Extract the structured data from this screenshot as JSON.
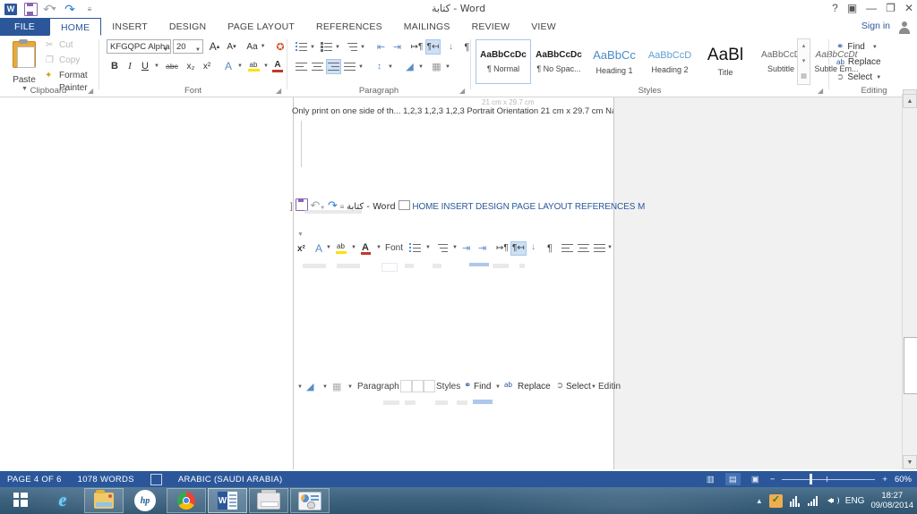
{
  "window": {
    "title": "كتابة - Word",
    "quick_access": [
      "word-logo",
      "save",
      "undo",
      "redo",
      "customize"
    ],
    "controls": {
      "help": "?",
      "ribbon_display": "▣",
      "minimize": "—",
      "restore": "❐",
      "close": "✕"
    }
  },
  "ribbon": {
    "tabs": [
      {
        "label": "FILE",
        "state": "file"
      },
      {
        "label": "HOME",
        "state": "active"
      },
      {
        "label": "INSERT",
        "state": "normal"
      },
      {
        "label": "DESIGN",
        "state": "normal"
      },
      {
        "label": "PAGE LAYOUT",
        "state": "normal"
      },
      {
        "label": "REFERENCES",
        "state": "normal"
      },
      {
        "label": "MAILINGS",
        "state": "normal"
      },
      {
        "label": "REVIEW",
        "state": "normal"
      },
      {
        "label": "VIEW",
        "state": "normal"
      }
    ],
    "sign_in": "Sign in",
    "collapse_caret": "︿",
    "groups": {
      "clipboard": {
        "label": "Clipboard",
        "paste": "Paste",
        "cut": "Cut",
        "copy": "Copy",
        "format_painter": "Format Painter"
      },
      "font": {
        "label": "Font",
        "font_name": "KFGQPC Alpha",
        "font_size": "20",
        "grow": "A",
        "shrink": "A",
        "change_case": "Aa",
        "clear_formatting": "clear-formatting-icon",
        "bold": "B",
        "italic": "I",
        "underline": "U",
        "strikethrough": "abc",
        "subscript": "x₂",
        "superscript": "x²",
        "text_effects": "A",
        "highlight": "ab",
        "font_color": "A"
      },
      "paragraph": {
        "label": "Paragraph",
        "bullets": "bullets-icon",
        "numbering": "numbering-icon",
        "multilevel": "multilevel-list-icon",
        "decrease_indent": "decrease-indent-icon",
        "increase_indent": "increase-indent-icon",
        "ltr": "ltr-icon",
        "rtl": "rtl-icon",
        "sort": "sort-icon",
        "show_marks": "¶",
        "align_left": "align-left-icon",
        "align_center": "align-center-icon",
        "align_right": "align-right-icon",
        "justify": "justify-icon",
        "line_spacing": "line-spacing-icon",
        "shading": "shading-icon",
        "borders": "borders-icon"
      },
      "styles": {
        "label": "Styles",
        "items": [
          {
            "preview": "AaBbCcDc",
            "name": "¶ Normal",
            "selected": true
          },
          {
            "preview": "AaBbCcDc",
            "name": "¶ No Spac...",
            "selected": false
          },
          {
            "preview": "AaBbCc",
            "name": "Heading 1",
            "selected": false
          },
          {
            "preview": "AaBbCcD",
            "name": "Heading 2",
            "selected": false
          },
          {
            "preview": "AaBl",
            "name": "Title",
            "selected": false
          },
          {
            "preview": "AaBbCcD",
            "name": "Subtitle",
            "selected": false
          },
          {
            "preview": "AaBbCcDt",
            "name": "Subtle Em...",
            "selected": false
          }
        ],
        "scroll_up": "▴",
        "scroll_down": "▾",
        "more": "▤"
      },
      "editing": {
        "label": "Editing",
        "find": "Find",
        "replace": "Replace",
        "select": "Select"
      }
    }
  },
  "artifacts": {
    "row_top_faint": "21 cm x 29.7 cm",
    "row_top": "Only print on one side of th...   1,2,3     1,2,3     1,2,3   Portrait Orientation  21 cm x 29.7 cm  Narro",
    "row_title": "كتابة - Word",
    "row_tabs": "HOME INSERT DESIGN PAGE LAYOUT REFERENCES M",
    "row_font_tools": "x²   A ▾   ab ▾   A ▾   Font",
    "row_para_tools": "¶",
    "row_bottom": "▾   ▾   ▾   Paragraph   Styles   Find  ▾   Replace   Select ▾   Editing"
  },
  "status_bar": {
    "page": "PAGE 4 OF 6",
    "words": "1078 WORDS",
    "proofing_icon": "proofing-errors-icon",
    "language": "ARABIC (SAUDI ARABIA)",
    "views": [
      {
        "name": "read-mode",
        "glyph": "▥",
        "selected": false
      },
      {
        "name": "print-layout",
        "glyph": "▤",
        "selected": true
      },
      {
        "name": "web-layout",
        "glyph": "▣",
        "selected": false
      }
    ],
    "zoom_out": "−",
    "zoom_in": "+",
    "zoom_level": "60%"
  },
  "taskbar": {
    "items": [
      {
        "name": "start-button",
        "label": "Start",
        "framed": false,
        "active": false
      },
      {
        "name": "internet-explorer",
        "label": "Internet Explorer",
        "framed": false,
        "active": false
      },
      {
        "name": "file-explorer",
        "label": "File Explorer",
        "framed": true,
        "active": false
      },
      {
        "name": "hp-app",
        "label": "HP",
        "framed": false,
        "active": false
      },
      {
        "name": "google-chrome",
        "label": "Google Chrome",
        "framed": true,
        "active": false
      },
      {
        "name": "microsoft-word",
        "label": "Microsoft Word",
        "framed": false,
        "active": true
      },
      {
        "name": "printer-app",
        "label": "Printer",
        "framed": true,
        "active": false
      },
      {
        "name": "control-panel",
        "label": "Control Panel",
        "framed": true,
        "active": false
      }
    ],
    "tray": {
      "show_hidden": "▲",
      "security_icon": "security-shield-icon",
      "network_icon": "network-icon",
      "signal_icon": "signal-strength-icon",
      "volume_icon": "volume-icon",
      "language": "ENG",
      "time": "18:27",
      "date": "09/08/2014"
    }
  }
}
